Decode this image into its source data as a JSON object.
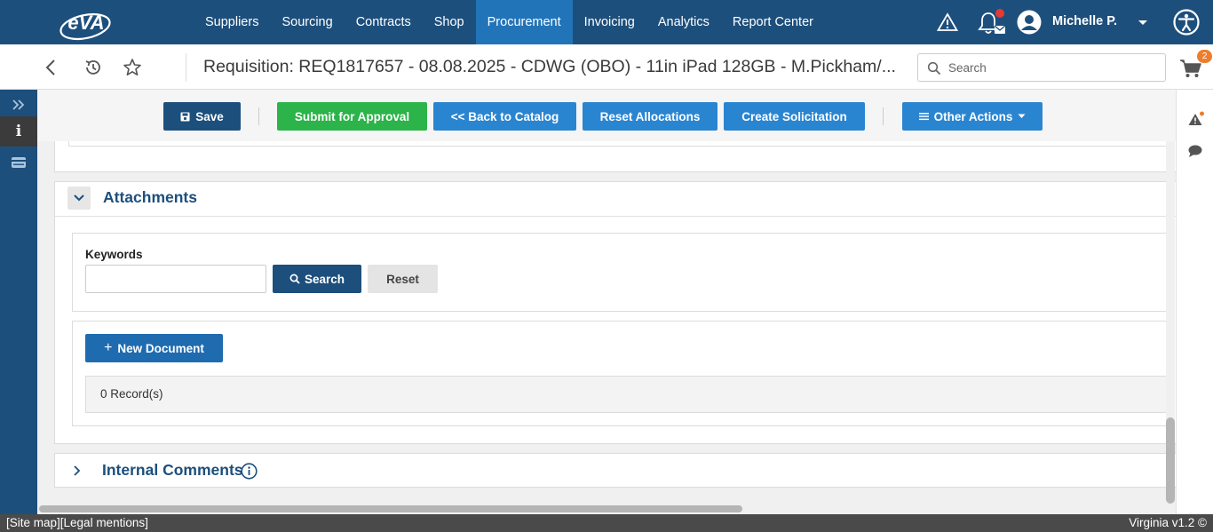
{
  "brand": {
    "logo_text": "eVA"
  },
  "nav": {
    "items": [
      {
        "label": "Suppliers"
      },
      {
        "label": "Sourcing"
      },
      {
        "label": "Contracts"
      },
      {
        "label": "Shop"
      },
      {
        "label": "Procurement",
        "active": true
      },
      {
        "label": "Invoicing"
      },
      {
        "label": "Analytics"
      },
      {
        "label": "Report Center"
      }
    ],
    "user_name": "Michelle P."
  },
  "titlebar": {
    "title": "Requisition: REQ1817657 - 08.08.2025 - CDWG (OBO) - 11in iPad 128GB - M.Pickham/...",
    "search_placeholder": "Search",
    "cart_count": "2"
  },
  "actions": {
    "save": "Save",
    "submit": "Submit for Approval",
    "back": "<< Back to Catalog",
    "reset_alloc": "Reset Allocations",
    "create_solicitation": "Create Solicitation",
    "other_actions": "Other Actions"
  },
  "attachments": {
    "title": "Attachments",
    "keywords_label": "Keywords",
    "keywords_value": "",
    "search_button": "Search",
    "reset_button": "Reset",
    "new_document_button": "New Document",
    "records": "0 Record(s)"
  },
  "internal_comments": {
    "title": "Internal Comments"
  },
  "footer": {
    "site_map": "[Site map]",
    "legal": "[Legal mentions]",
    "version": "Virginia v1.2 ©"
  },
  "colors": {
    "nav_bg": "#1d4f7c",
    "nav_active": "#2274b9",
    "green": "#2cb34a",
    "blue": "#2a85d1",
    "badge": "#ee7d2b",
    "alert_red": "#e53935"
  }
}
